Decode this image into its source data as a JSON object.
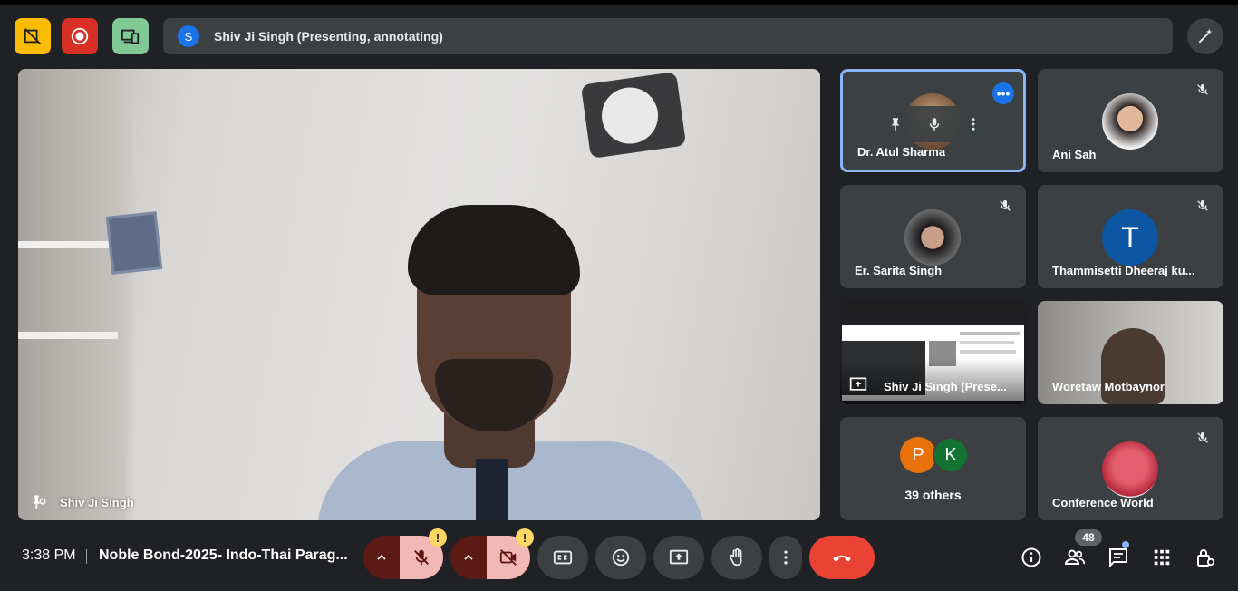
{
  "top_bar": {
    "presenter_avatar_letter": "S",
    "presenter_text": "Shiv Ji Singh (Presenting, annotating)",
    "icons": [
      "no-recording-icon",
      "recording-icon",
      "companion-mode-icon",
      "annotate-icon"
    ]
  },
  "main_video": {
    "participant_name": "Shiv Ji Singh"
  },
  "tiles": [
    {
      "name": "Dr. Atul Sharma",
      "state": "active-speaker"
    },
    {
      "name": "Ani Sah",
      "muted": true
    },
    {
      "name": "Er. Sarita Singh",
      "muted": true
    },
    {
      "name": "Thammisetti Dheeraj ku...",
      "avatar_letter": "T",
      "muted": true
    },
    {
      "name": "Shiv Ji Singh (Prese...",
      "type": "screen-share"
    },
    {
      "name": "Woretaw Motbaynor"
    },
    {
      "avatar_letters": [
        "P",
        "K"
      ],
      "label": "39 others"
    },
    {
      "name": "Conference World",
      "muted": true
    }
  ],
  "bottom_bar": {
    "time": "3:38 PM",
    "meeting_title": "Noble Bond-2025- Indo-Thai Parag...",
    "warning_glyph": "!",
    "participant_count": "48"
  },
  "colors": {
    "background": "#202124",
    "tile": "#3c4043",
    "end_call": "#ea4335",
    "mic_cam_off": "#f28b82",
    "accent_blue": "#8ab4f8",
    "warning": "#fdd663"
  }
}
